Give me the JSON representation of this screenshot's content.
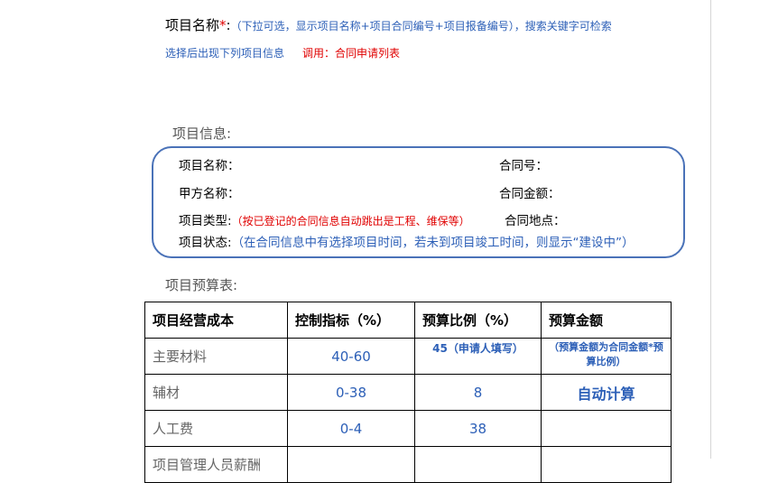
{
  "instruction": {
    "label": "项目名称",
    "required_mark": "*",
    "colon": ":",
    "hint_line1": "（下拉可选，显示项目名称+项目合同编号+项目报备编号），搜索关键字可检索",
    "hint_line2": "选择后出现下列项目信息",
    "call_note": "调用：合同申请列表"
  },
  "project_info": {
    "heading": "项目信息:",
    "fields": {
      "project_name": "项目名称：",
      "contract_no": "合同号：",
      "party_a": "甲方名称：",
      "contract_amount": "合同金额：",
      "project_type": "项目类型:",
      "project_type_note": "（按已登记的合同信息自动跳出是工程、维保等）",
      "contract_location": "合同地点：",
      "project_status": "项目状态:",
      "project_status_note": "（在合同信息中有选择项目时间，若未到项目竣工时间，则显示“建设中”）"
    }
  },
  "budget": {
    "heading": "项目预算表:",
    "columns": [
      "项目经营成本",
      "控制指标（%）",
      "预算比例（%）",
      "预算金额"
    ],
    "rows": [
      {
        "item": "主要材料",
        "control": "40-60",
        "ratio": "45（申请人填写）",
        "amount": "（预算金额为合同金额*预算比例）"
      },
      {
        "item": "辅材",
        "control": "0-38",
        "ratio": "8",
        "amount": "自动计算"
      },
      {
        "item": "人工费",
        "control": "0-4",
        "ratio": "38",
        "amount": ""
      },
      {
        "item": "项目管理人员薪酬",
        "control": "",
        "ratio": "",
        "amount": ""
      }
    ]
  },
  "colors": {
    "accent_blue": "#2c5fb7",
    "required_red": "#e00000",
    "box_border": "#4a72b8"
  }
}
